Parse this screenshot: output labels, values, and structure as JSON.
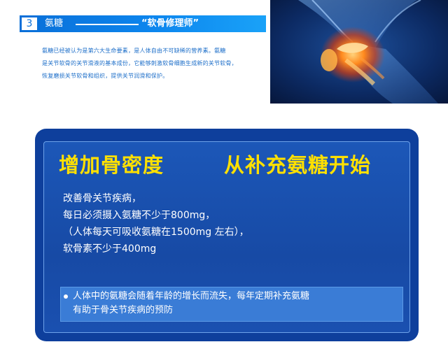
{
  "section": {
    "number": "3",
    "title": "氨糖",
    "subtitle": "“软骨修理师”"
  },
  "intro": {
    "lines": [
      "氨糖已经被认为是第六大生命要素，是人体自由不可缺稀的营养素。氨糖",
      "是关节软骨的关节滑液的基本成份，它能够刺激软骨细胞生成新的关节软骨，",
      "恢复磨损关节软骨和组织，提供关节润滑和保护。"
    ]
  },
  "panel": {
    "headline_left": "增加骨密度",
    "headline_right": "从补充氨糖开始",
    "lines": [
      "改善骨关节疾病，",
      "每日必须摄入氨糖不少于800mg，",
      "（人体每天可吸收氨糖在1500mg 左右），",
      "软骨素不少于400mg"
    ],
    "note_lines": [
      "人体中的氨糖会随着年龄的增长而流失，每年定期补充氨糖",
      "有助于骨关节疾病的预防"
    ]
  },
  "colors": {
    "title_bar": "#0a6fd8",
    "intro_text": "#1e6fc9",
    "panel_outer": "#0e3f9c",
    "headline": "#ffe000",
    "note_bg": "#3a7cd6"
  },
  "image": {
    "icon": "knee-joint-xray-illustration"
  }
}
